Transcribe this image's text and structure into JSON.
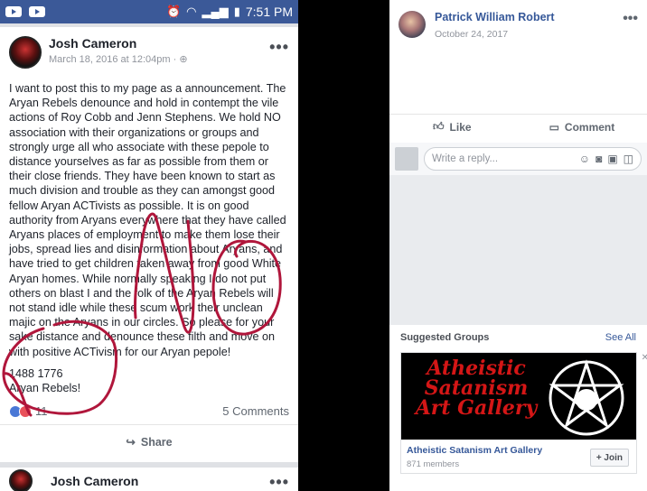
{
  "status_bar": {
    "time": "7:51 PM"
  },
  "post": {
    "author": "Josh Cameron",
    "timestamp": "March 18, 2016 at 12:04pm",
    "privacy_glyph": "·",
    "body": "I want to post this to my page as a announcement. The Aryan Rebels denounce and hold in contempt the vile actions of Roy Cobb and Jenn Stephens. We hold NO association with their organizations or groups and strongly urge all who associate with these pepole to distance yourselves as far as possible from them or their close friends. They have been known to start as much division and trouble as they can amongst good fellow Aryan ACTivists as possible. It is on good authority from Aryans everywhere that they have called Aryans places of employment to make them lose their jobs, spread lies and disinformation about Aryans, and have tried to get children taken away from good White Aryan homes. While normally speaking I do not put others on blast I and the folk of the Aryan Rebels will not stand idle while these scum work their unclean majic on the Aryans in our circles. So please for your sake distance and denounce these filth and move on with positive ACTivism for our Aryan pepole!",
    "tag_line1": "1488 1776",
    "tag_line2": "Aryan Rebels!",
    "reaction_count": "11",
    "comments_label": "5 Comments",
    "share_label": "Share",
    "scribble_text": "NO"
  },
  "next_post": {
    "author": "Josh Cameron"
  },
  "comment": {
    "author": "Patrick William Robert",
    "date": "October 24, 2017",
    "like_label": "Like",
    "comment_label": "Comment",
    "reply_placeholder": "Write a reply..."
  },
  "suggested": {
    "title": "Suggested Groups",
    "see_all": "See All",
    "group_image_text": "Atheistic Satanism Art Gallery",
    "group_name": "Atheistic Satanism Art Gallery",
    "members": "871 members",
    "join_label": "+ Join"
  },
  "colors": {
    "fb_blue": "#3b5998",
    "link_blue": "#365899",
    "scribble": "#b0163b",
    "logo_red": "#d41616"
  }
}
